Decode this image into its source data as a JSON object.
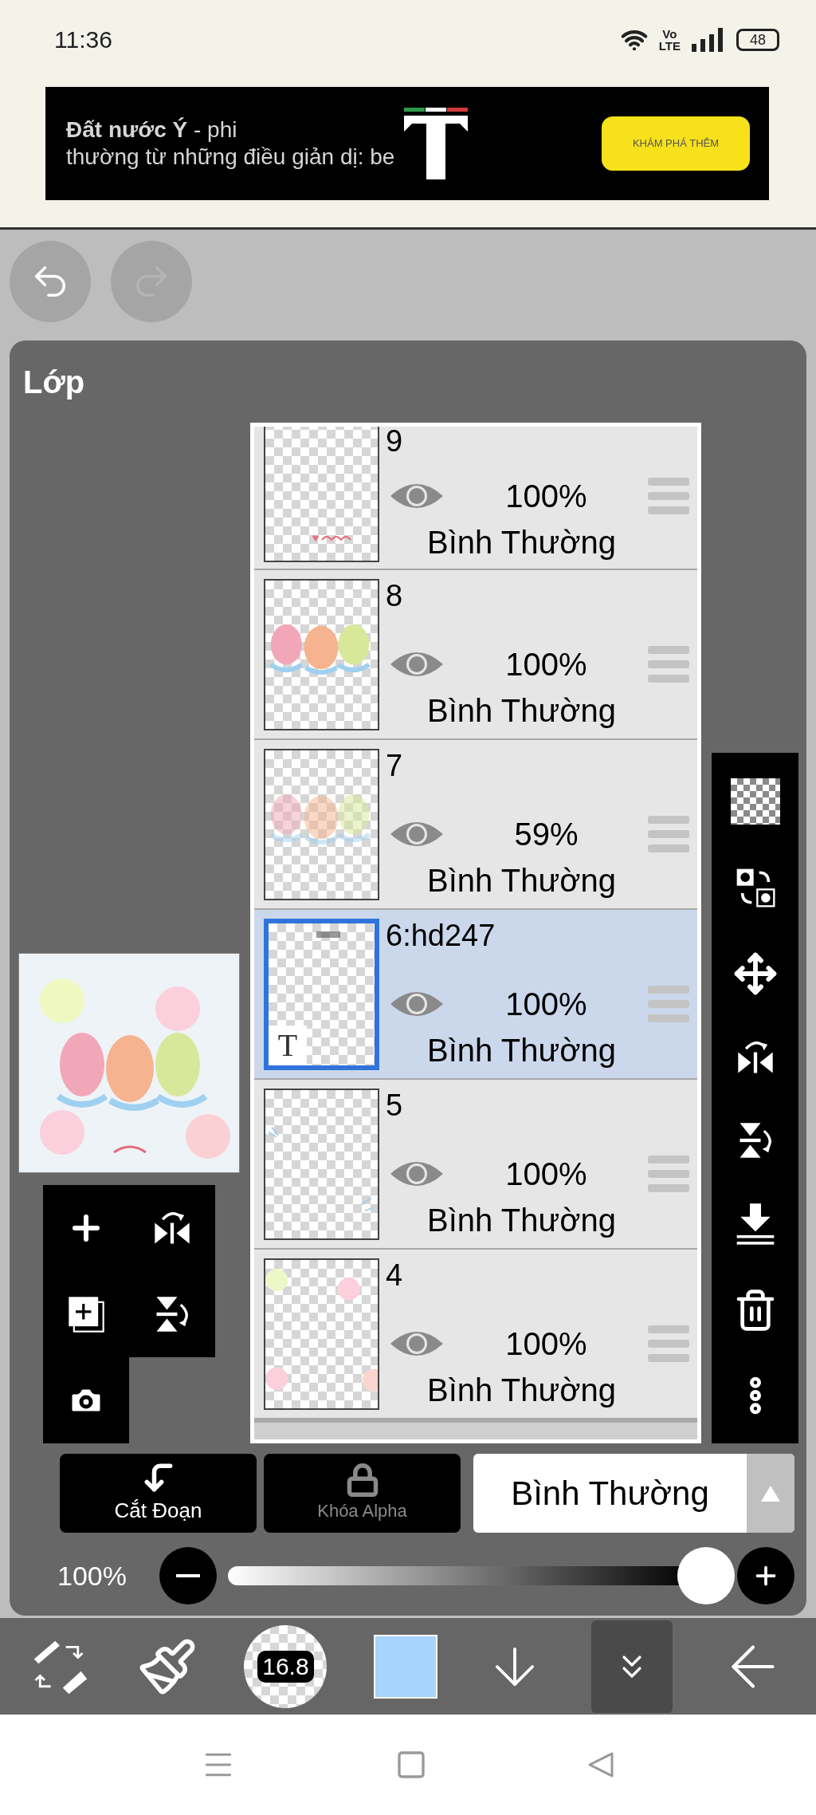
{
  "status_bar": {
    "time": "11:36",
    "network_top": "Vo",
    "network_bottom": "LTE",
    "battery": "48"
  },
  "ad": {
    "lines": [
      "**Đất nước Ý** - phi",
      "thường từ những điều giản dị: be"
    ],
    "button": "KHÁM PHÁ THÊM"
  },
  "panel": {
    "title": "Lớp"
  },
  "layers": [
    {
      "name": "9",
      "opacity": "100%",
      "blend": "Bình Thường",
      "visible": true,
      "selected": false,
      "kind": "caption"
    },
    {
      "name": "8",
      "opacity": "100%",
      "blend": "Bình Thường",
      "visible": true,
      "selected": false,
      "kind": "sos"
    },
    {
      "name": "7",
      "opacity": "59%",
      "blend": "Bình Thường",
      "visible": true,
      "selected": false,
      "kind": "faded"
    },
    {
      "name": "6:hd247",
      "opacity": "100%",
      "blend": "Bình Thường",
      "visible": true,
      "selected": true,
      "kind": "text",
      "badge": "T"
    },
    {
      "name": "5",
      "opacity": "100%",
      "blend": "Bình Thường",
      "visible": true,
      "selected": false,
      "kind": "sparkles"
    },
    {
      "name": "4",
      "opacity": "100%",
      "blend": "Bình Thường",
      "visible": true,
      "selected": false,
      "kind": "dots"
    }
  ],
  "buttons": [
    {
      "label": "Cắt Đoạn",
      "disabled": false
    },
    {
      "label": "Khóa Alpha",
      "disabled": true
    }
  ],
  "blend_mode": "Bình Thường",
  "opacity": {
    "reading": "100%",
    "level": 1.0
  },
  "toolbar": {
    "brush_size": "16.8",
    "color": "#a6d4fa"
  }
}
